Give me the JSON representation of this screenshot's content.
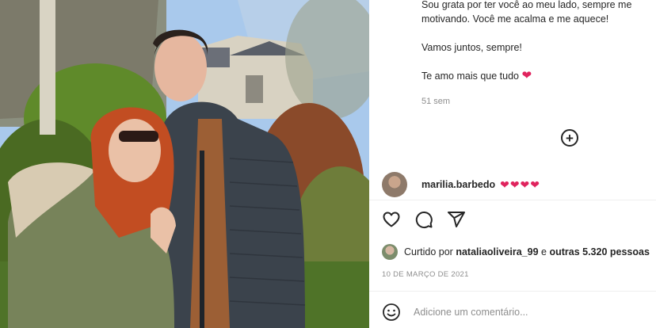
{
  "post": {
    "caption_lines": [
      "Sou grata por ter você ao meu lado, sempre me",
      "motivando. Você me acalma e me aquece!",
      "",
      "Vamos juntos, sempre!",
      "",
      "Te amo mais que tudo"
    ],
    "caption_heart": "❤",
    "time_ago": "51 sem",
    "load_more_symbol": "+",
    "photo_alt": "couple-photo"
  },
  "comment": {
    "username": "marilia.barbedo",
    "text": "❤❤❤❤"
  },
  "actions": {
    "like_icon": "heart-icon",
    "comment_icon": "comment-icon",
    "share_icon": "share-icon"
  },
  "likes": {
    "prefix": "Curtido por ",
    "user": "nataliaoliveira_99",
    "middle": " e ",
    "others": "outras 5.320 pessoas"
  },
  "date": "10 DE MARÇO DE 2021",
  "add_comment": {
    "emoji_icon": "emoji-icon",
    "placeholder": "Adicione um comentário..."
  },
  "colors": {
    "heart": "#e0245e",
    "text": "#262626",
    "muted": "#8e8e8e"
  }
}
